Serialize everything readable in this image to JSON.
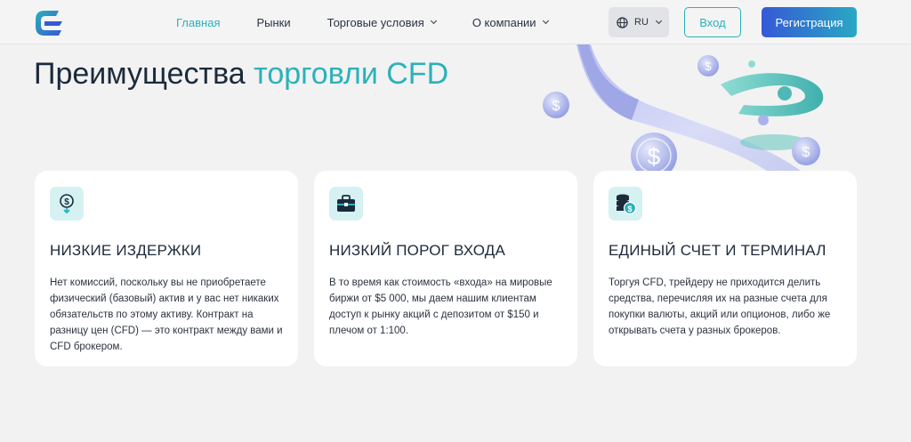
{
  "header": {
    "nav": [
      {
        "label": "Главная",
        "active": true,
        "dropdown": false
      },
      {
        "label": "Рынки",
        "active": false,
        "dropdown": false
      },
      {
        "label": "Торговые условия",
        "active": false,
        "dropdown": true
      },
      {
        "label": "О компании",
        "active": false,
        "dropdown": true
      }
    ],
    "lang": "RU",
    "login_label": "Вход",
    "register_label": "Регистрация"
  },
  "hero": {
    "title_part1": "Преимущества ",
    "title_part2": "торговли CFD"
  },
  "cards": [
    {
      "icon": "money-down-icon",
      "title": "НИЗКИЕ ИЗДЕРЖКИ",
      "text": "Нет комиссий, поскольку вы не приобретаете физический (базовый) актив и у вас нет никаких обязательств по этому активу. Контракт на разницу цен (CFD) — это контракт между вами и CFD брокером."
    },
    {
      "icon": "briefcase-icon",
      "title": "НИЗКИЙ ПОРОГ ВХОДА",
      "text": "В то время как стоимость «входа» на мировые биржи от $5 000, мы даем нашим клиентам доступ к рынку акций с депозитом от $150 и плечом от 1:100."
    },
    {
      "icon": "coins-stack-icon",
      "title": "ЕДИНЫЙ СЧЕТ И ТЕРМИНАЛ",
      "text": "Торгуя CFD, трейдеру не приходится делить средства, перечисляя их на разные счета для покупки валюты, акций или опционов, либо же открывать счета у разных брокеров."
    }
  ],
  "colors": {
    "accent": "#2bb1b9",
    "brand_blue": "#3559d6",
    "background": "#f2f2f3",
    "card": "#ffffff",
    "icon_bg": "#d6f1f2"
  }
}
